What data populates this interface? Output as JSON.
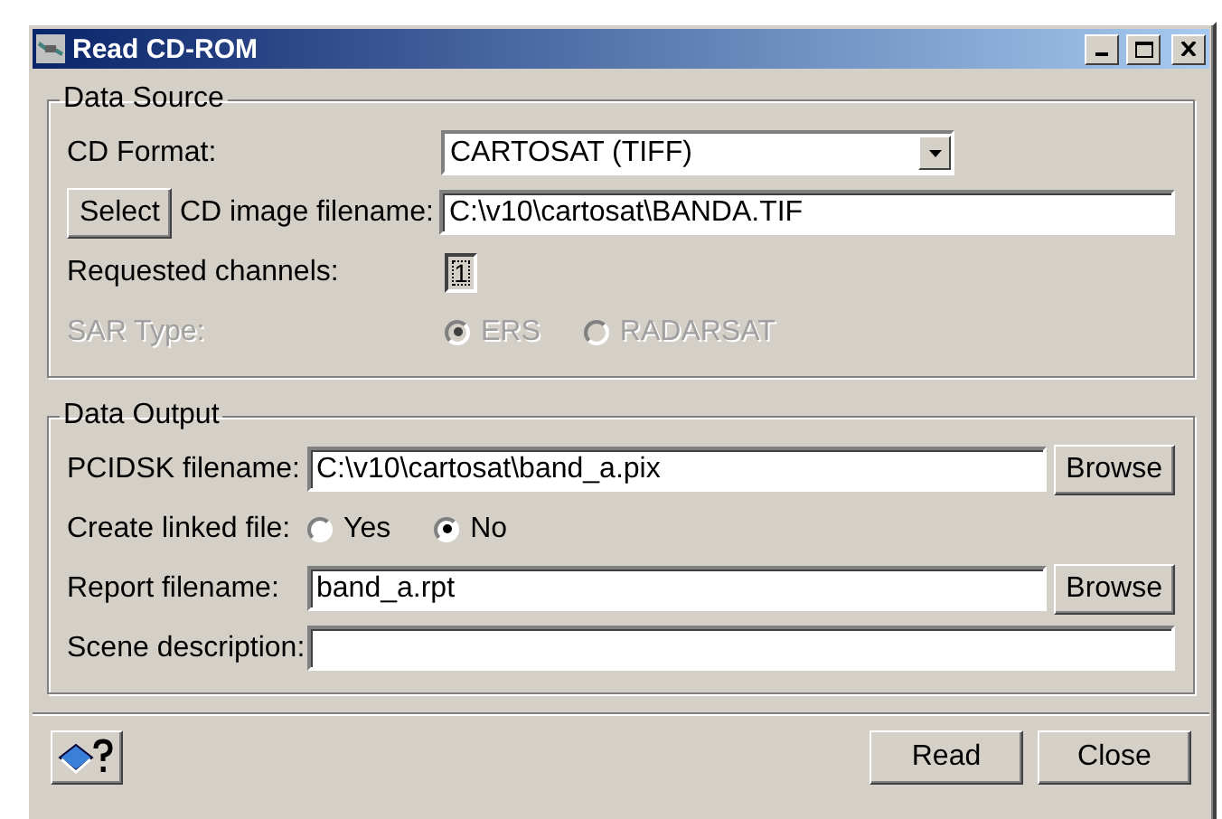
{
  "window": {
    "title": "Read CD-ROM"
  },
  "data_source": {
    "title": "Data Source",
    "cd_format": {
      "label": "CD Format:",
      "value": "CARTOSAT (TIFF)"
    },
    "select_button": "Select",
    "image_filename": {
      "label": "CD image filename:",
      "value": "C:\\v10\\cartosat\\BANDA.TIF"
    },
    "requested_channels": {
      "label": "Requested channels:",
      "value": "1"
    },
    "sar_type": {
      "label": "SAR Type:",
      "disabled": true,
      "options": [
        {
          "label": "ERS",
          "selected": true
        },
        {
          "label": "RADARSAT",
          "selected": false
        }
      ]
    }
  },
  "data_output": {
    "title": "Data Output",
    "pcidsk": {
      "label": "PCIDSK filename:",
      "value": "C:\\v10\\cartosat\\band_a.pix",
      "button": "Browse"
    },
    "linked": {
      "label": "Create linked file:",
      "disabled": false,
      "options": [
        {
          "label": "Yes",
          "selected": false
        },
        {
          "label": "No",
          "selected": true
        }
      ]
    },
    "report": {
      "label": "Report filename:",
      "value": "band_a.rpt",
      "button": "Browse"
    },
    "scene": {
      "label": "Scene description:"
    }
  },
  "buttons": [
    "Read",
    "Close"
  ]
}
